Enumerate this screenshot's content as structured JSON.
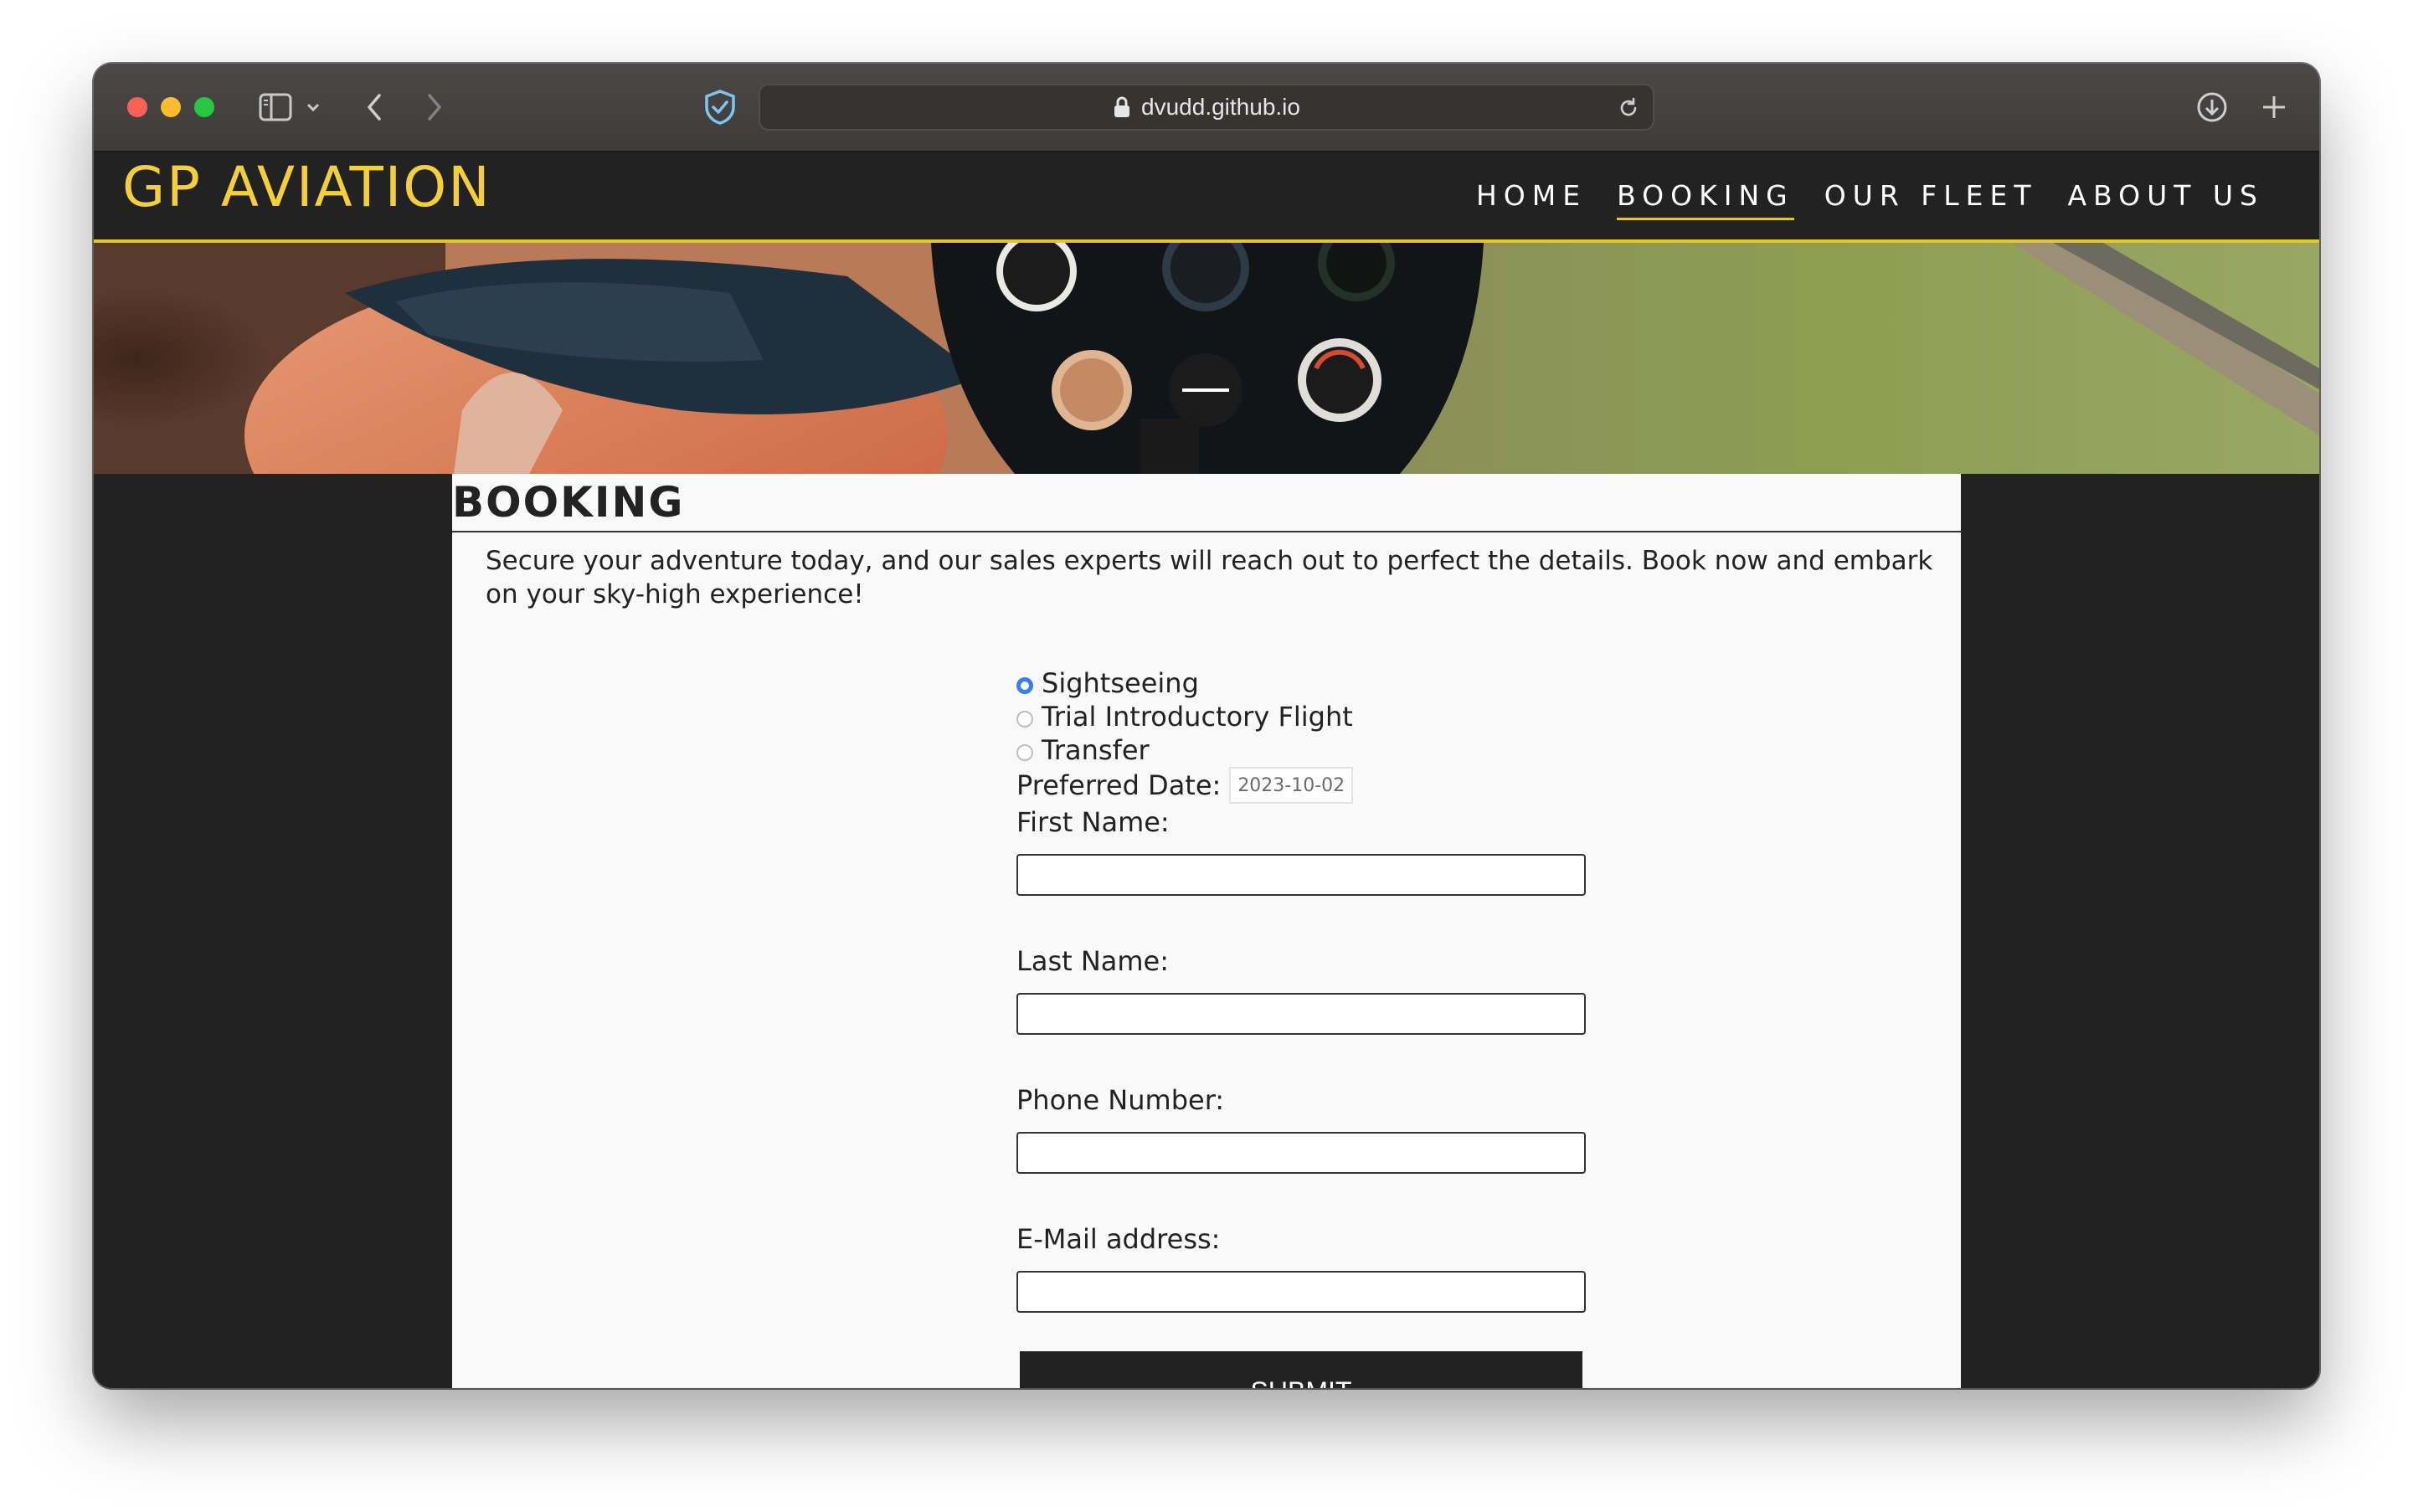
{
  "browser": {
    "url": "dvudd.github.io"
  },
  "site": {
    "logo": "GP AVIATION",
    "nav": [
      {
        "label": "HOME",
        "active": false
      },
      {
        "label": "BOOKING",
        "active": true
      },
      {
        "label": "OUR FLEET",
        "active": false
      },
      {
        "label": "ABOUT US",
        "active": false
      }
    ],
    "accent_color": "#e8c33a"
  },
  "booking": {
    "title": "BOOKING",
    "intro": "Secure your adventure today, and our sales experts will reach out to perfect the details. Book now and embark on your sky-high experience!",
    "options": [
      {
        "label": "Sightseeing",
        "checked": true
      },
      {
        "label": "Trial Introductory Flight",
        "checked": false
      },
      {
        "label": "Transfer",
        "checked": false
      }
    ],
    "date_label": "Preferred Date:",
    "date_value": "2023-10-02",
    "fields": {
      "first_name": "First Name:",
      "last_name": "Last Name:",
      "phone": "Phone Number:",
      "email": "E-Mail address:"
    },
    "submit_label": "SUBMIT"
  }
}
